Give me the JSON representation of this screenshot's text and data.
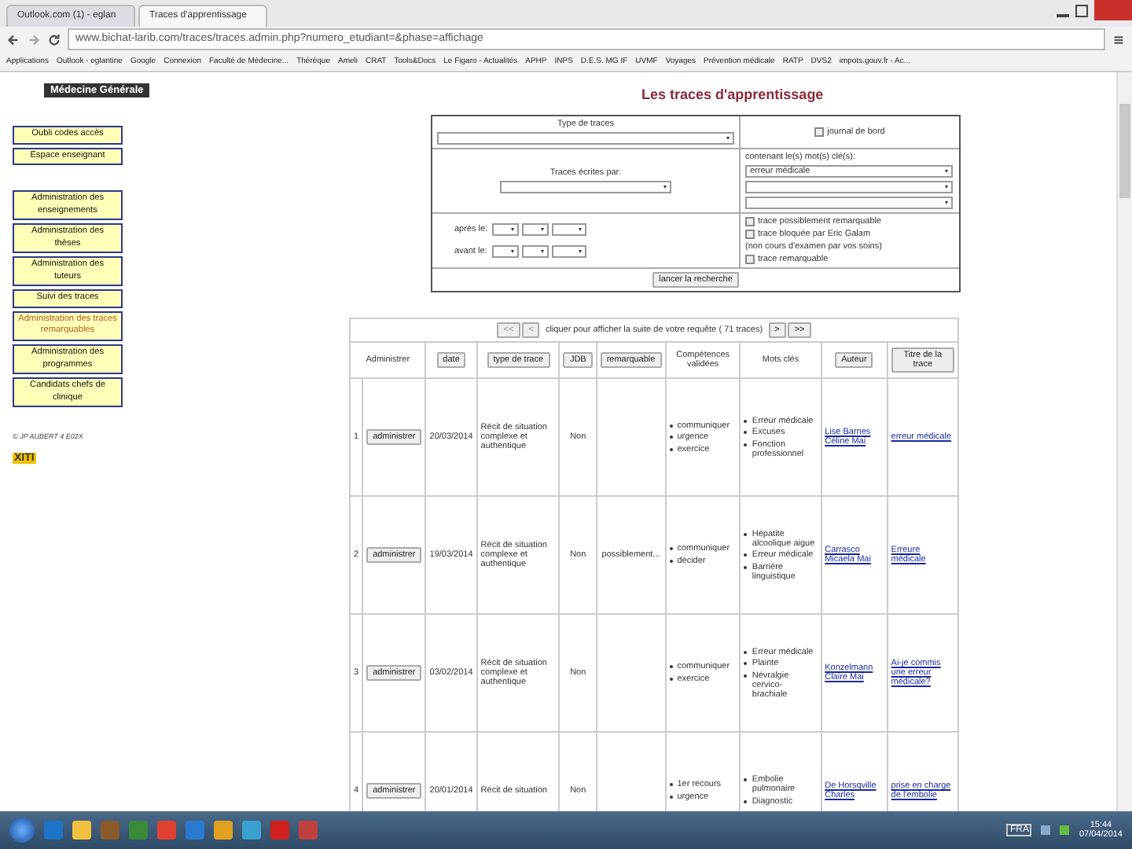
{
  "browser": {
    "tabs": [
      {
        "label": "Outlook.com (1) - eglan",
        "selected": false
      },
      {
        "label": "Traces d'apprentissage",
        "selected": true
      }
    ],
    "url": "www.bichat-larib.com/traces/traces.admin.php?numero_etudiant=&phase=affichage",
    "bookmarks": [
      "Applications",
      "Outlook - eglantine",
      "Google",
      "Connexion",
      "Faculté de Médecine...",
      "Thérèque",
      "Ameli",
      "CRAT",
      "Tools&Docs",
      "Le Figaro - Actualités",
      "APHP",
      "INPS",
      "D.E.S. MG IF",
      "UVMF",
      "Voyages",
      "Prévention médicale",
      "RATP",
      "DVS2",
      "impots.gouv.fr - Ac..."
    ]
  },
  "site_label": "Médecine Générale",
  "nav": {
    "groups": [
      [
        {
          "label": "Oubli codes accès",
          "selected": false
        },
        {
          "label": "Espace enseignant",
          "selected": false
        }
      ],
      [
        {
          "label": "Administration des enseignements",
          "selected": false
        },
        {
          "label": "Administration des thèses",
          "selected": false
        },
        {
          "label": "Administration des tuteurs",
          "selected": false
        },
        {
          "label": "Suivi des traces",
          "selected": false
        },
        {
          "label": "Administration des traces remarquables",
          "selected": true
        },
        {
          "label": "Administration des programmes",
          "selected": false
        },
        {
          "label": "Candidats chefs de clinique",
          "selected": false
        }
      ]
    ],
    "credit": "© JP AUBERT 4 E02X",
    "logo": "XITI"
  },
  "title": "Les traces d'apprentissage",
  "search": {
    "type_label": "Type de traces",
    "journal": {
      "label": "journal de bord",
      "checked": false
    },
    "author_label": "Traces écrites par:",
    "keywords_label": "contenant le(s) mot(s) clé(s):",
    "keywords": [
      {
        "kind": "filled",
        "value": "erreur médicale"
      },
      {
        "kind": "blank"
      },
      {
        "kind": "blank"
      }
    ],
    "after_label": "après le:",
    "before_label": "avant le:",
    "flags": [
      {
        "label": "trace possiblement remarquable",
        "checked": false
      },
      {
        "label": "trace bloquée par Eric Galam",
        "checked": false,
        "note": "(non cours d'examen par vos soins)"
      },
      {
        "label": "trace remarquable",
        "checked": false
      }
    ],
    "button": "lancer la recherche"
  },
  "results": {
    "pager": {
      "first": "<<",
      "prev": "<",
      "text": "cliquer pour afficher la suite de votre requête ( 71 traces)",
      "next": ">",
      "last": ">>"
    },
    "columns": [
      {
        "label": "Administrer",
        "kind": "text"
      },
      {
        "label": "date",
        "kind": "button"
      },
      {
        "label": "type de trace",
        "kind": "button"
      },
      {
        "label": "JDB",
        "kind": "button"
      },
      {
        "label": "remarquable",
        "kind": "button"
      },
      {
        "label": "Compétences validées",
        "kind": "text"
      },
      {
        "label": "Mots clés",
        "kind": "text"
      },
      {
        "label": "Auteur",
        "kind": "button"
      },
      {
        "label": "Titre de la trace",
        "kind": "button"
      }
    ],
    "rows": [
      {
        "index": "1",
        "action": "administrer",
        "date": "20/03/2014",
        "type": "Récit de situation complexe et authentique",
        "jdb": "Non",
        "remarquable": "",
        "competences": [
          "communiquer",
          "urgence",
          "exercice"
        ],
        "keywords": [
          "Erreur médicale",
          "Excuses",
          "Fonction professionnel"
        ],
        "author": "Lise Barnes Céline Mai",
        "title": "erreur médicale"
      },
      {
        "index": "2",
        "action": "administrer",
        "date": "19/03/2014",
        "type": "Récit de situation complexe et authentique",
        "jdb": "Non",
        "remarquable": "possiblement...",
        "competences": [
          "communiquer",
          "décider"
        ],
        "keywords": [
          "Hépatite alcoolique aigue",
          "Erreur médicale",
          "Barrière linguistique"
        ],
        "author": "Carrasco Micaela Mai",
        "title": "Erreure médicale"
      },
      {
        "index": "3",
        "action": "administrer",
        "date": "03/02/2014",
        "type": "Récit de situation complexe et authentique",
        "jdb": "Non",
        "remarquable": "",
        "competences": [
          "communiquer",
          "exercice"
        ],
        "keywords": [
          "Erreur médicale",
          "Plainte",
          "Névralgie cervico-brachiale"
        ],
        "author": "Konzelmann Claire Mai",
        "title": "Ai-je commis une erreur médicale?"
      },
      {
        "index": "4",
        "action": "administrer",
        "date": "20/01/2014",
        "type": "Récit de situation",
        "jdb": "Non",
        "remarquable": "",
        "competences": [
          "1er recours",
          "urgence"
        ],
        "keywords": [
          "Embolie pulmonaire",
          "Diagnostic"
        ],
        "author": "De Horsqville Charles",
        "title": "prise en charge de l'embolie"
      }
    ]
  },
  "taskbar": {
    "language": "FRA",
    "time": "15:44",
    "date": "07/04/2014"
  }
}
